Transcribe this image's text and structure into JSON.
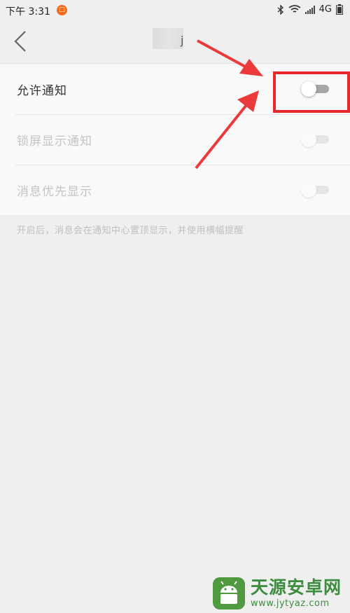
{
  "status_bar": {
    "time": "下午 3:31",
    "app_badge": "□",
    "network": "4G"
  },
  "nav": {
    "title_visible_fragment": "j"
  },
  "settings": {
    "items": [
      {
        "label": "允许通知",
        "enabled": true,
        "on": false
      },
      {
        "label": "锁屏显示通知",
        "enabled": false,
        "on": false
      },
      {
        "label": "消息优先显示",
        "enabled": false,
        "on": false
      }
    ],
    "hint": "开启后，消息会在通知中心置顶显示，并使用横幅提醒"
  },
  "annotation": {
    "color": "#e8292c"
  },
  "watermark": {
    "name": "天源安卓网",
    "url": "www.jytyaz.com"
  }
}
